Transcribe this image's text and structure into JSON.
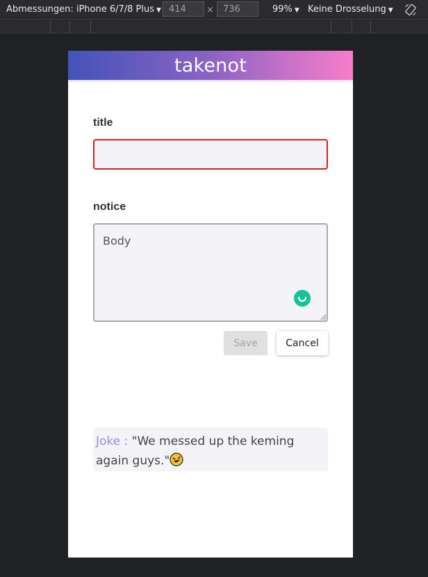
{
  "devtools": {
    "dimensions_label": "Abmessungen: iPhone 6/7/8 Plus",
    "width_value": "414",
    "times_sign": "×",
    "height_value": "736",
    "zoom": "99%",
    "throttling": "Keine Drosselung"
  },
  "app": {
    "title": "takenot"
  },
  "form": {
    "title_label": "title",
    "title_value": "",
    "notice_label": "notice",
    "notice_placeholder": "Body",
    "save_label": "Save",
    "cancel_label": "Cancel"
  },
  "joke": {
    "label": "Joke :",
    "text": "\"We messed up the keming again guys.\""
  },
  "colors": {
    "header_gradient_start": "#4353b8",
    "header_gradient_end": "#f87dcb",
    "title_input_border": "#d61f1f",
    "joke_label": "#9b8ad4"
  }
}
